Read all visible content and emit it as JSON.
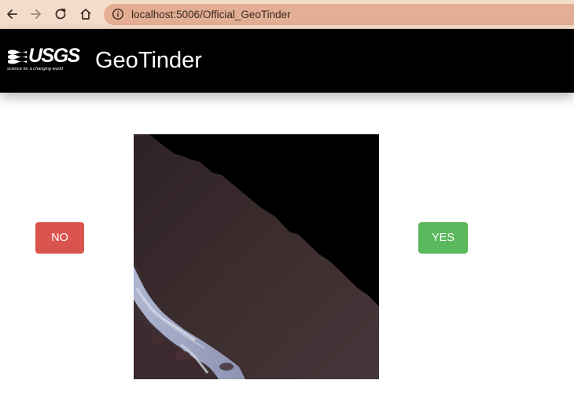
{
  "browser": {
    "url": "localhost:5006/Official_GeoTinder",
    "icons": [
      "back-arrow-icon",
      "forward-arrow-icon",
      "reload-icon",
      "home-icon",
      "info-icon"
    ]
  },
  "header": {
    "logo_text": "USGS",
    "logo_tagline": "science for a changing world",
    "title": "GeoTinder"
  },
  "main": {
    "no_label": "NO",
    "yes_label": "YES",
    "colors": {
      "no_button": "#d9534f",
      "yes_button": "#5cb85c",
      "header_background": "#000000"
    }
  }
}
